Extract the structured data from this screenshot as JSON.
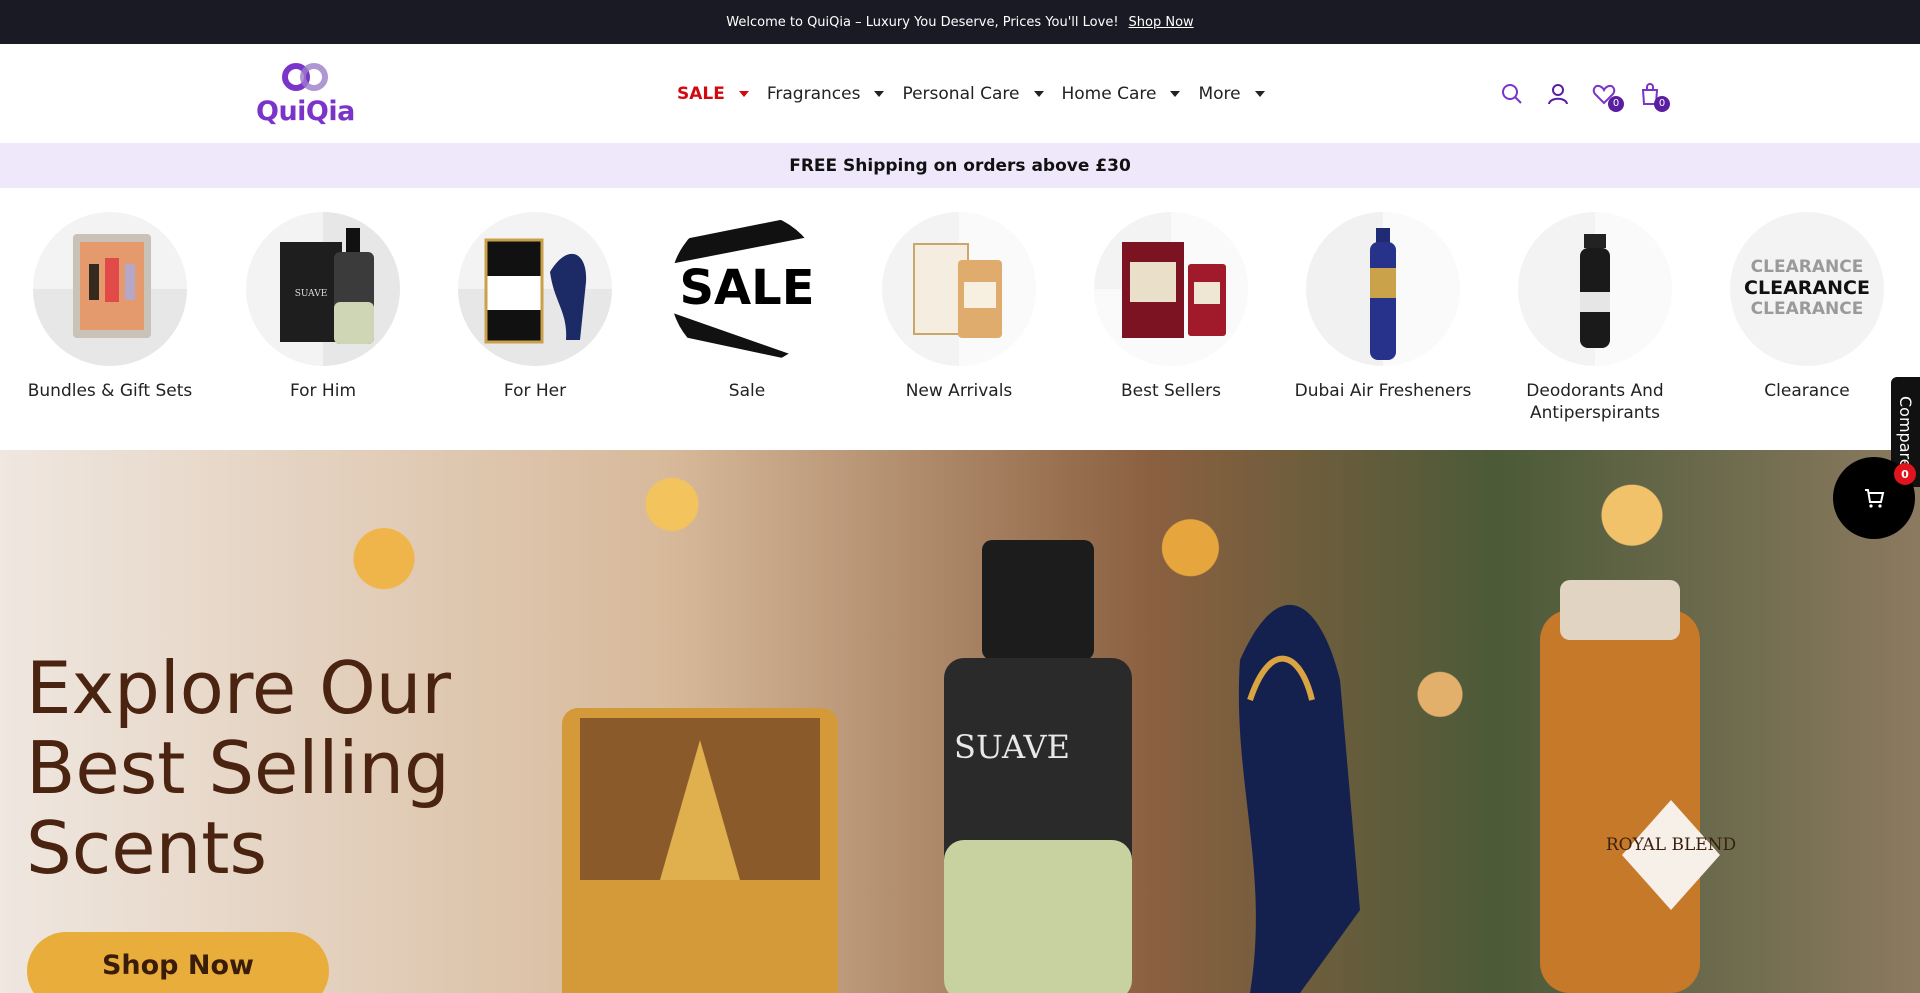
{
  "announcement": {
    "text": "Welcome to QuiQia – Luxury You Deserve, Prices You'll Love!",
    "link": "Shop Now"
  },
  "header": {
    "logo_text": "QuiQia",
    "nav": [
      {
        "label": "SALE"
      },
      {
        "label": "Fragrances"
      },
      {
        "label": "Personal Care"
      },
      {
        "label": "Home Care"
      },
      {
        "label": "More"
      }
    ],
    "icons": [
      "search-icon",
      "account-icon",
      "wishlist-icon",
      "cart-icon"
    ],
    "wishlist_count": "0",
    "cart_count": "0",
    "brand_color": "#7b34c9",
    "sale_color": "#d10a10"
  },
  "shipping": {
    "text": "FREE Shipping on orders above £30 "
  },
  "categories": [
    {
      "label": "Bundles & Gift Sets"
    },
    {
      "label": "For Him"
    },
    {
      "label": "For Her"
    },
    {
      "label": "Sale"
    },
    {
      "label": "New Arrivals"
    },
    {
      "label": "Best Sellers"
    },
    {
      "label": "Dubai Air Fresheners"
    },
    {
      "label": "Deodorants And Antiperspirants"
    },
    {
      "label": "Clearance"
    }
  ],
  "hero": {
    "title_line1": "Explore Our",
    "title_line2": "Best Selling",
    "title_line3": "Scents",
    "button": "Shop Now",
    "bottle_label_1": "SUAVE",
    "bottle_label_2": "ROYAL BLEND"
  },
  "compare": {
    "label": "Compare"
  },
  "floating_cart": {
    "count": "0"
  },
  "images": {
    "sale_text": "SALE",
    "clearance_text": "CLEARANCE",
    "for_him_text": "SUAVE"
  }
}
